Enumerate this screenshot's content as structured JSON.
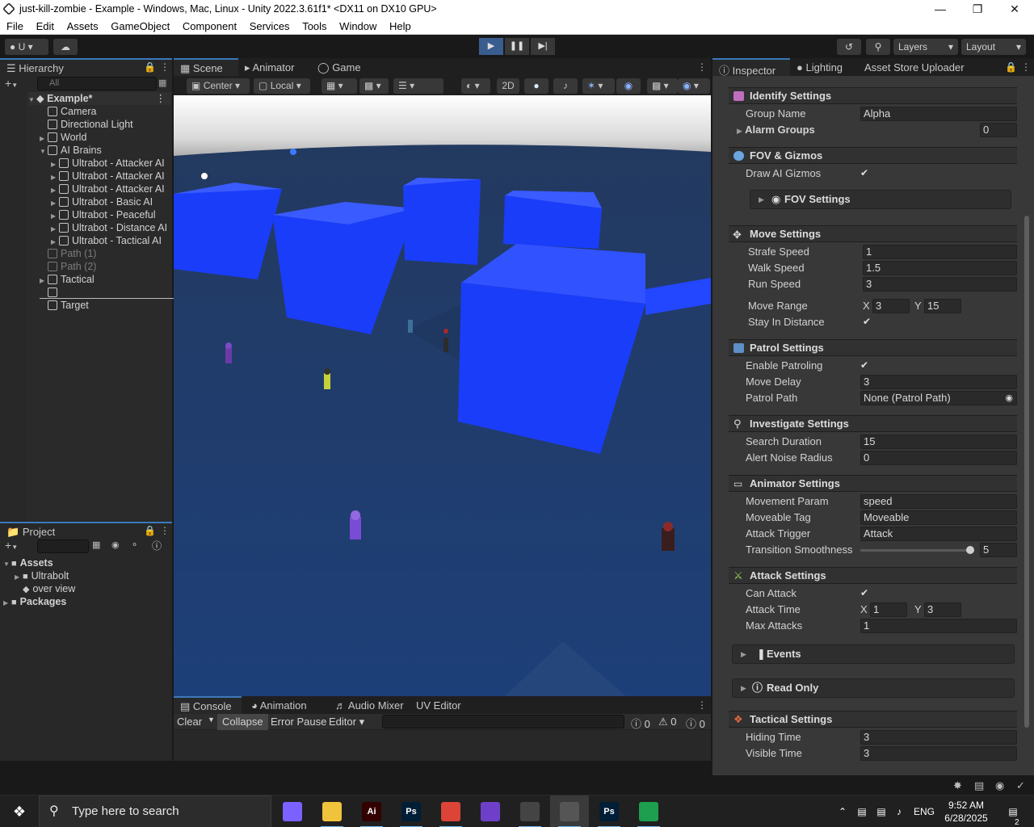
{
  "titlebar": {
    "title": "just-kill-zombie - Example - Windows, Mac, Linux - Unity 2022.3.61f1* <DX11 on DX10 GPU>",
    "minimize": "—",
    "maximize": "❐",
    "close": "✕"
  },
  "menu": [
    "File",
    "Edit",
    "Assets",
    "GameObject",
    "Component",
    "Services",
    "Tools",
    "Window",
    "Help"
  ],
  "toolbar": {
    "account": "U",
    "layers": "Layers",
    "layout": "Layout"
  },
  "hierarchy": {
    "tab": "Hierarchy",
    "search_placeholder": "All",
    "scene_name": "Example*",
    "items": [
      {
        "label": "Camera",
        "depth": 1,
        "arrow": "",
        "dim": false
      },
      {
        "label": "Directional Light",
        "depth": 1,
        "arrow": "",
        "dim": false
      },
      {
        "label": "World",
        "depth": 1,
        "arrow": "▶",
        "dim": false
      },
      {
        "label": "AI Brains",
        "depth": 1,
        "arrow": "▼",
        "dim": false
      },
      {
        "label": "Ultrabot - Attacker AI",
        "depth": 2,
        "arrow": "▶",
        "dim": false
      },
      {
        "label": "Ultrabot - Attacker AI",
        "depth": 2,
        "arrow": "▶",
        "dim": false
      },
      {
        "label": "Ultrabot - Attacker AI",
        "depth": 2,
        "arrow": "▶",
        "dim": false
      },
      {
        "label": "Ultrabot - Basic AI",
        "depth": 2,
        "arrow": "▶",
        "dim": false
      },
      {
        "label": "Ultrabot - Peaceful",
        "depth": 2,
        "arrow": "▶",
        "dim": false
      },
      {
        "label": "Ultrabot - Distance AI",
        "depth": 2,
        "arrow": "▶",
        "dim": false
      },
      {
        "label": "Ultrabot - Tactical AI",
        "depth": 2,
        "arrow": "▶",
        "dim": false
      },
      {
        "label": "Path (1)",
        "depth": 1,
        "arrow": "",
        "dim": true
      },
      {
        "label": "Path (2)",
        "depth": 1,
        "arrow": "",
        "dim": true
      },
      {
        "label": "Tactical",
        "depth": 1,
        "arrow": "▶",
        "dim": false
      },
      {
        "label": "",
        "depth": 1,
        "arrow": "",
        "dim": false
      },
      {
        "label": "Target",
        "depth": 1,
        "arrow": "",
        "dim": false
      }
    ]
  },
  "project": {
    "tab": "Project",
    "items": [
      {
        "label": "Assets",
        "depth": 0,
        "arrow": "▼",
        "bold": true
      },
      {
        "label": "Ultrabolt",
        "depth": 1,
        "arrow": "▶",
        "bold": false
      },
      {
        "label": "over view",
        "depth": 1,
        "arrow": "",
        "bold": false
      },
      {
        "label": "Packages",
        "depth": 0,
        "arrow": "▶",
        "bold": true
      }
    ]
  },
  "scene": {
    "tabs": [
      "Scene",
      "Animator",
      "Game"
    ],
    "pivot": "Center",
    "space": "Local",
    "mode_2d": "2D"
  },
  "console": {
    "tabs": [
      "Console",
      "Animation",
      "Audio Mixer",
      "UV Editor"
    ],
    "clear": "Clear",
    "collapse": "Collapse",
    "error_pause": "Error Pause",
    "editor": "Editor",
    "counts": {
      "info": "0",
      "warn": "0",
      "error": "0"
    }
  },
  "inspector": {
    "tabs": [
      "Inspector",
      "Lighting",
      "Asset Store Uploader"
    ],
    "sections": {
      "identify": "Identify Settings",
      "fov": "FOV & Gizmos",
      "move": "Move Settings",
      "patrol": "Patrol Settings",
      "investigate": "Investigate Settings",
      "animator": "Animator Settings",
      "attack": "Attack Settings",
      "tactical": "Tactical Settings"
    },
    "group_name": {
      "label": "Group Name",
      "value": "Alpha"
    },
    "alarm_groups": {
      "label": "Alarm Groups",
      "value": "0"
    },
    "draw_gizmos": {
      "label": "Draw AI Gizmos",
      "check": "✔"
    },
    "fov_settings": "FOV Settings",
    "strafe_speed": {
      "label": "Strafe Speed",
      "value": "1"
    },
    "walk_speed": {
      "label": "Walk Speed",
      "value": "1.5"
    },
    "run_speed": {
      "label": "Run Speed",
      "value": "3"
    },
    "move_range": {
      "label": "Move Range",
      "x_label": "X",
      "x": "3",
      "y_label": "Y",
      "y": "15"
    },
    "stay_in_distance": {
      "label": "Stay In Distance",
      "check": "✔"
    },
    "enable_patroling": {
      "label": "Enable Patroling",
      "check": "✔"
    },
    "move_delay": {
      "label": "Move Delay",
      "value": "3"
    },
    "patrol_path": {
      "label": "Patrol Path",
      "value": "None (Patrol Path)"
    },
    "search_duration": {
      "label": "Search Duration",
      "value": "15"
    },
    "alert_noise_radius": {
      "label": "Alert Noise Radius",
      "value": "0"
    },
    "movement_param": {
      "label": "Movement Param",
      "value": "speed"
    },
    "moveable_tag": {
      "label": "Moveable Tag",
      "value": "Moveable"
    },
    "attack_trigger": {
      "label": "Attack Trigger",
      "value": "Attack"
    },
    "transition_smoothness": {
      "label": "Transition Smoothness",
      "value": "5",
      "fraction": 1.0
    },
    "can_attack": {
      "label": "Can Attack",
      "check": "✔"
    },
    "attack_time": {
      "label": "Attack Time",
      "x_label": "X",
      "x": "1",
      "y_label": "Y",
      "y": "3"
    },
    "max_attacks": {
      "label": "Max Attacks",
      "value": "1"
    },
    "events": "Events",
    "read_only": "Read Only",
    "hiding_time": {
      "label": "Hiding Time",
      "value": "3"
    },
    "visible_time": {
      "label": "Visible Time",
      "value": "3"
    }
  },
  "taskbar": {
    "search_placeholder": "Type here to search",
    "lang": "ENG",
    "time": "9:52 AM",
    "date": "6/28/2025",
    "notif_count": "2",
    "apps": [
      {
        "icon": "copilot-icon",
        "glyph": "",
        "color": "#7b61ff"
      },
      {
        "icon": "file-explorer-icon",
        "glyph": "",
        "color": "#f0c33c"
      },
      {
        "icon": "illustrator-icon",
        "glyph": "Ai",
        "color": "#330000"
      },
      {
        "icon": "photoshop-icon",
        "glyph": "Ps",
        "color": "#001e36"
      },
      {
        "icon": "chrome-icon",
        "glyph": "",
        "color": "#db4437"
      },
      {
        "icon": "github-icon",
        "glyph": "",
        "color": "#6e40c9"
      },
      {
        "icon": "unity-hub-icon",
        "glyph": "",
        "color": "#444"
      },
      {
        "icon": "unity-icon",
        "glyph": "",
        "color": "#555"
      },
      {
        "icon": "photoshop-icon-2",
        "glyph": "Ps",
        "color": "#001e36"
      },
      {
        "icon": "game-controller-icon",
        "glyph": "",
        "color": "#1e9e4f"
      }
    ]
  },
  "colors": {
    "accent": "#3a79bb",
    "cube": "#1a3cff",
    "ground": "#1f3a66"
  }
}
